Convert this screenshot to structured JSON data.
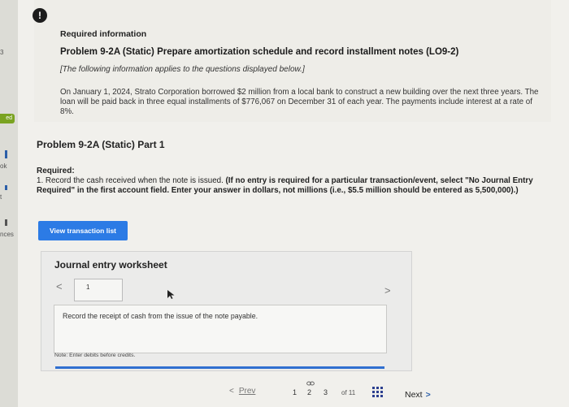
{
  "sidebar": {
    "fragments": [
      "3",
      "ed",
      "ok",
      "t",
      "nces"
    ]
  },
  "header": {
    "required_info": "Required information",
    "problem_title": "Problem 9-2A (Static) Prepare amortization schedule and record installment notes (LO9-2)",
    "applies_note": "[The following information applies to the questions displayed below.]",
    "scenario": "On January 1, 2024, Strato Corporation borrowed $2 million from a local bank to construct a new building over the next three years. The loan will be paid back in three equal installments of $776,067 on December 31 of each year. The payments include interest at a rate of 8%."
  },
  "part": {
    "title": "Problem 9-2A (Static) Part 1",
    "required_label": "Required:",
    "required_plain": "1. Record the cash received when the note is issued. ",
    "required_bold": "(If no entry is required for a particular transaction/event, select \"No Journal Entry Required\" in the first account field. Enter your answer in dollars, not millions (i.e., $5.5 million should be entered as 5,500,000).)"
  },
  "view_button_label": "View transaction list",
  "worksheet": {
    "title": "Journal entry worksheet",
    "prev_arrow": "<",
    "next_arrow": ">",
    "current_page": "1",
    "description": "Record the receipt of cash from the issue of the note payable.",
    "note": "Note: Enter debits before credits."
  },
  "pagination": {
    "prev_label": "Prev",
    "pages": [
      "1",
      "2",
      "3"
    ],
    "of_label": "of 11",
    "next_label": "Next",
    "prev_chevron": "<",
    "next_chevron": ">"
  }
}
